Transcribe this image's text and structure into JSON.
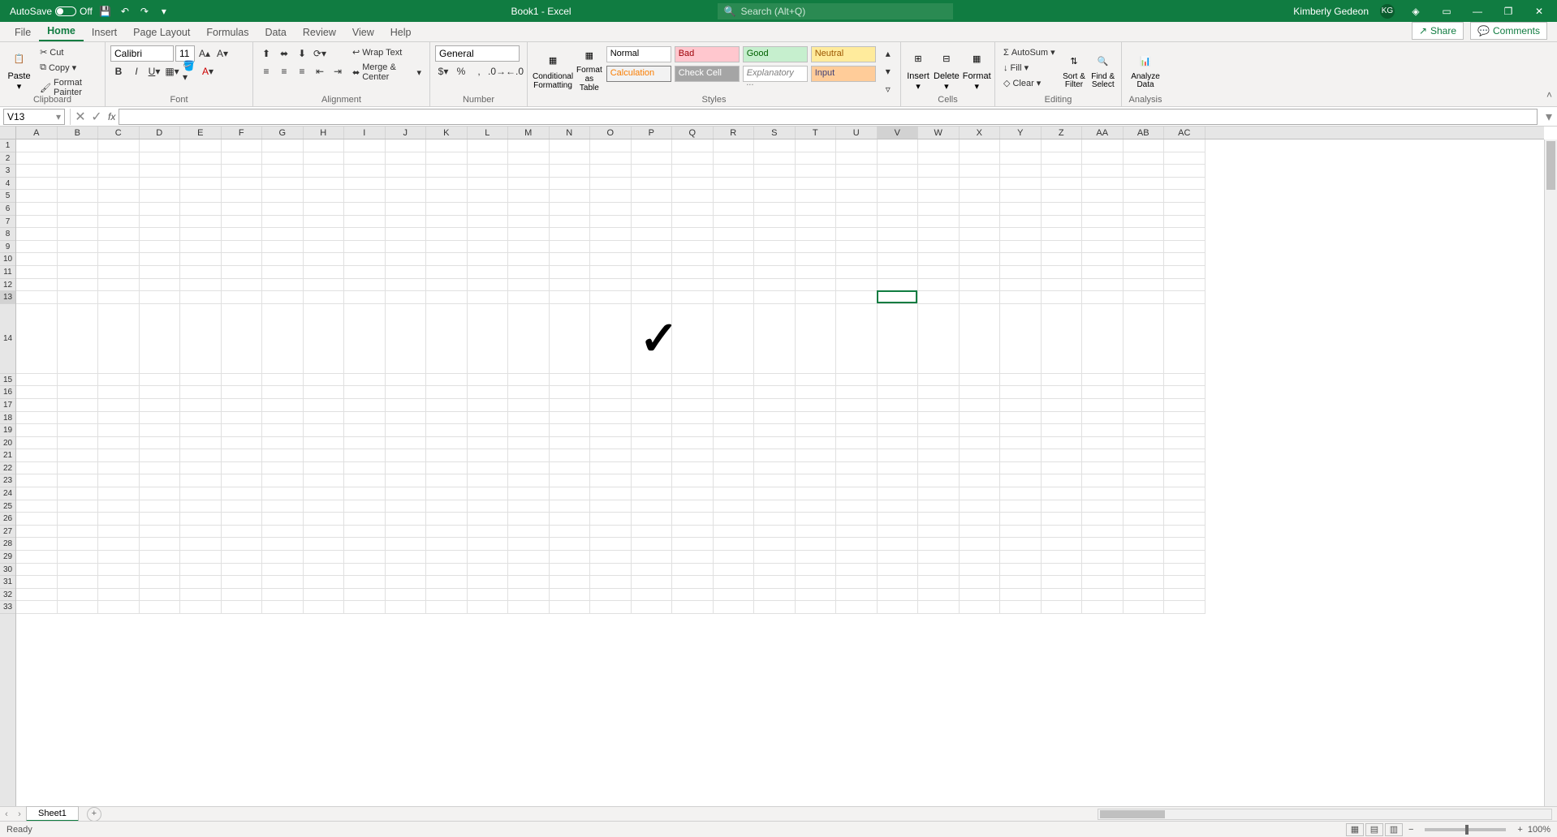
{
  "titlebar": {
    "autosave_label": "AutoSave",
    "autosave_state": "Off",
    "document_title": "Book1  -  Excel",
    "search_placeholder": "Search (Alt+Q)",
    "user_name": "Kimberly Gedeon",
    "user_initials": "KG"
  },
  "tabs": {
    "items": [
      "File",
      "Home",
      "Insert",
      "Page Layout",
      "Formulas",
      "Data",
      "Review",
      "View",
      "Help"
    ],
    "active": "Home",
    "share": "Share",
    "comments": "Comments"
  },
  "ribbon": {
    "clipboard": {
      "paste": "Paste",
      "cut": "Cut",
      "copy": "Copy",
      "format_painter": "Format Painter",
      "label": "Clipboard"
    },
    "font": {
      "name": "Calibri",
      "size": "11",
      "label": "Font"
    },
    "alignment": {
      "wrap": "Wrap Text",
      "merge": "Merge & Center",
      "label": "Alignment"
    },
    "number": {
      "format": "General",
      "label": "Number"
    },
    "styles": {
      "cond_fmt": "Conditional Formatting",
      "fmt_table": "Format as Table",
      "cells": [
        {
          "key": "normal",
          "label": "Normal"
        },
        {
          "key": "bad",
          "label": "Bad"
        },
        {
          "key": "good",
          "label": "Good"
        },
        {
          "key": "neutral",
          "label": "Neutral"
        },
        {
          "key": "calc",
          "label": "Calculation"
        },
        {
          "key": "check",
          "label": "Check Cell"
        },
        {
          "key": "explan",
          "label": "Explanatory ..."
        },
        {
          "key": "input",
          "label": "Input"
        }
      ],
      "label": "Styles"
    },
    "cells_group": {
      "insert": "Insert",
      "delete": "Delete",
      "format": "Format",
      "label": "Cells"
    },
    "editing": {
      "autosum": "AutoSum",
      "fill": "Fill",
      "clear": "Clear",
      "sort": "Sort & Filter",
      "find": "Find & Select",
      "label": "Editing"
    },
    "analysis": {
      "analyze": "Analyze Data",
      "label": "Analysis"
    }
  },
  "formula_bar": {
    "name_box": "V13",
    "formula": ""
  },
  "grid": {
    "columns": [
      "A",
      "B",
      "C",
      "D",
      "E",
      "F",
      "G",
      "H",
      "I",
      "J",
      "K",
      "L",
      "M",
      "N",
      "O",
      "P",
      "Q",
      "R",
      "S",
      "T",
      "U",
      "V",
      "W",
      "X",
      "Y",
      "Z",
      "AA",
      "AB",
      "AC"
    ],
    "row_count": 33,
    "tall_row": 14,
    "active_cell": "V13",
    "active_col_index": 21,
    "active_row_index": 12,
    "checkmark_glyph": "✓"
  },
  "sheets": {
    "nav_prev": "‹",
    "nav_next": "›",
    "active": "Sheet1",
    "add": "+"
  },
  "status": {
    "ready": "Ready",
    "zoom": "100%"
  },
  "colors": {
    "brand": "#107c41"
  }
}
